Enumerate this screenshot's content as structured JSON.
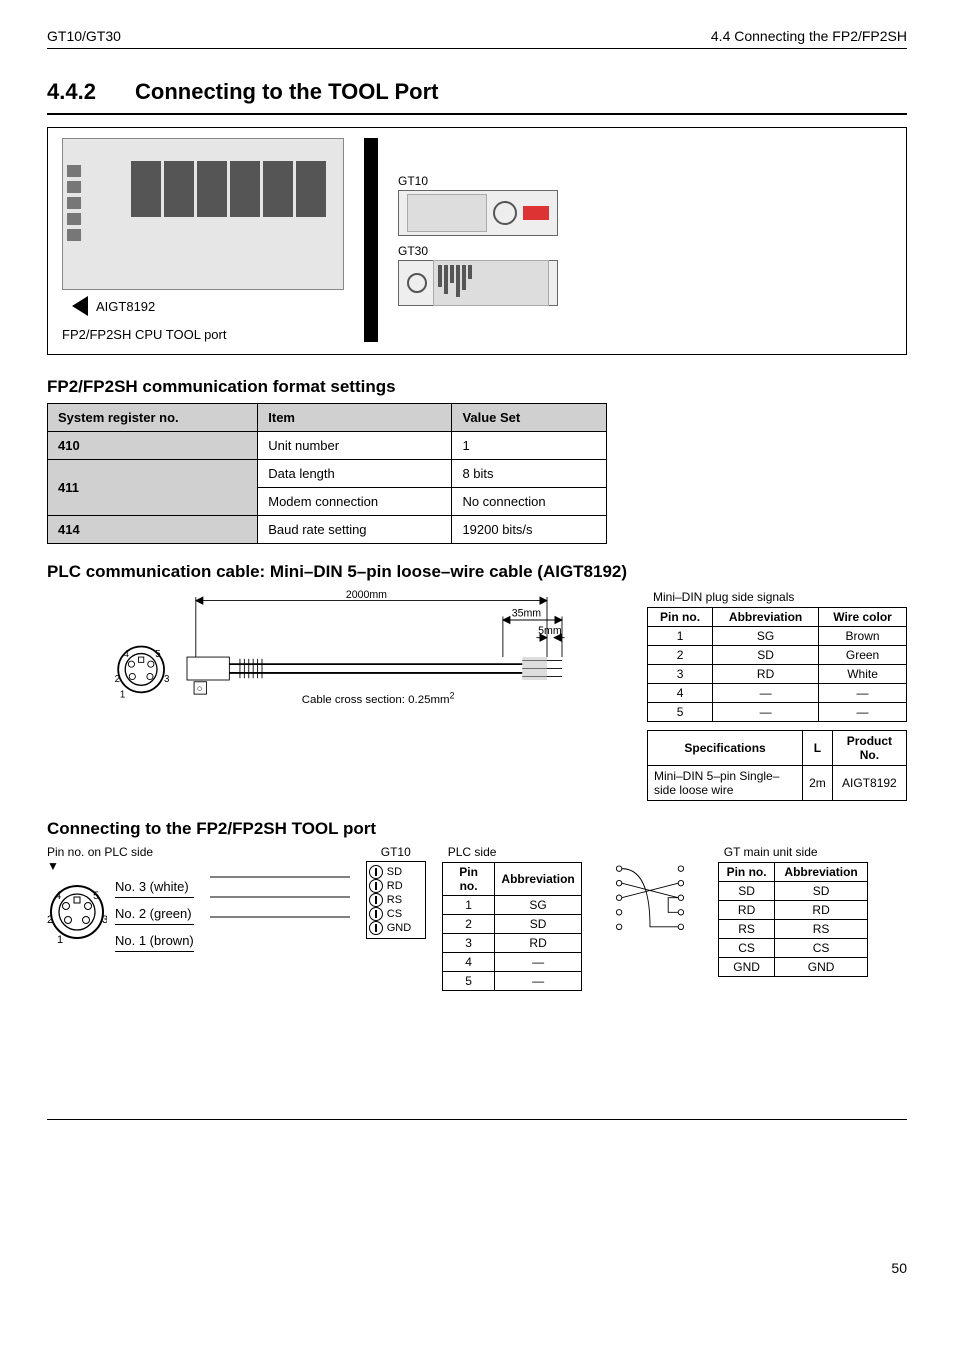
{
  "header": {
    "left": "GT10/GT30",
    "right": "4.4   Connecting the FP2/FP2SH"
  },
  "section": {
    "number": "4.4.2",
    "title": "Connecting to the TOOL Port"
  },
  "figure": {
    "cable_label": "AIGT8192",
    "port_caption": "FP2/FP2SH CPU TOOL port",
    "displays": [
      {
        "name": "GT10"
      },
      {
        "name": "GT30"
      }
    ]
  },
  "settings": {
    "title": "FP2/FP2SH communication format settings",
    "columns": [
      "System register no.",
      "Item",
      "Value Set"
    ],
    "rows": [
      {
        "reg": "410",
        "item": "Unit number",
        "value": "1"
      },
      {
        "reg": "411",
        "item": "Data length",
        "value": "8 bits"
      },
      {
        "reg": "411",
        "item": "Modem connection",
        "value": "No connection"
      },
      {
        "reg": "414",
        "item": "Baud rate setting",
        "value": "19200 bits/s"
      }
    ]
  },
  "cable": {
    "title": "PLC communication cable: Mini–DIN 5–pin loose–wire cable (AIGT8192)",
    "length_label": "2000mm",
    "strip_label": "35mm",
    "tip_label": "5mm",
    "cross_section_label": "Cable cross section: 0.25mm",
    "cross_section_exp": "2",
    "signals_caption": "Mini–DIN plug side signals",
    "signals_columns": [
      "Pin no.",
      "Abbreviation",
      "Wire color"
    ],
    "signals_rows": [
      [
        "1",
        "SG",
        "Brown"
      ],
      [
        "2",
        "SD",
        "Green"
      ],
      [
        "3",
        "RD",
        "White"
      ],
      [
        "4",
        "—",
        "—"
      ],
      [
        "5",
        "—",
        "—"
      ]
    ],
    "spec_columns": [
      "Specifications",
      "L",
      "Product No."
    ],
    "spec_row": [
      "Mini–DIN 5–pin Single–side loose wire",
      "2m",
      "AIGT8192"
    ]
  },
  "wiring": {
    "title": "Connecting to the FP2/FP2SH TOOL port",
    "pin_caption": "Pin no. on PLC side",
    "wires": [
      "No. 3 (white)",
      "No. 2 (green)",
      "No. 1 (brown)"
    ],
    "terminal_label": "GT10",
    "terminal_pins": [
      "SD",
      "RD",
      "RS",
      "CS",
      "GND"
    ],
    "plc_table": {
      "caption": "PLC side",
      "columns": [
        "Pin no.",
        "Abbreviation"
      ],
      "rows": [
        [
          "1",
          "SG"
        ],
        [
          "2",
          "SD"
        ],
        [
          "3",
          "RD"
        ],
        [
          "4",
          "—"
        ],
        [
          "5",
          "—"
        ]
      ]
    },
    "gt_table": {
      "caption": "GT main unit side",
      "columns": [
        "Pin no.",
        "Abbreviation"
      ],
      "rows": [
        [
          "SD",
          "SD"
        ],
        [
          "RD",
          "RD"
        ],
        [
          "RS",
          "RS"
        ],
        [
          "CS",
          "CS"
        ],
        [
          "GND",
          "GND"
        ]
      ]
    }
  },
  "page_number": "50"
}
